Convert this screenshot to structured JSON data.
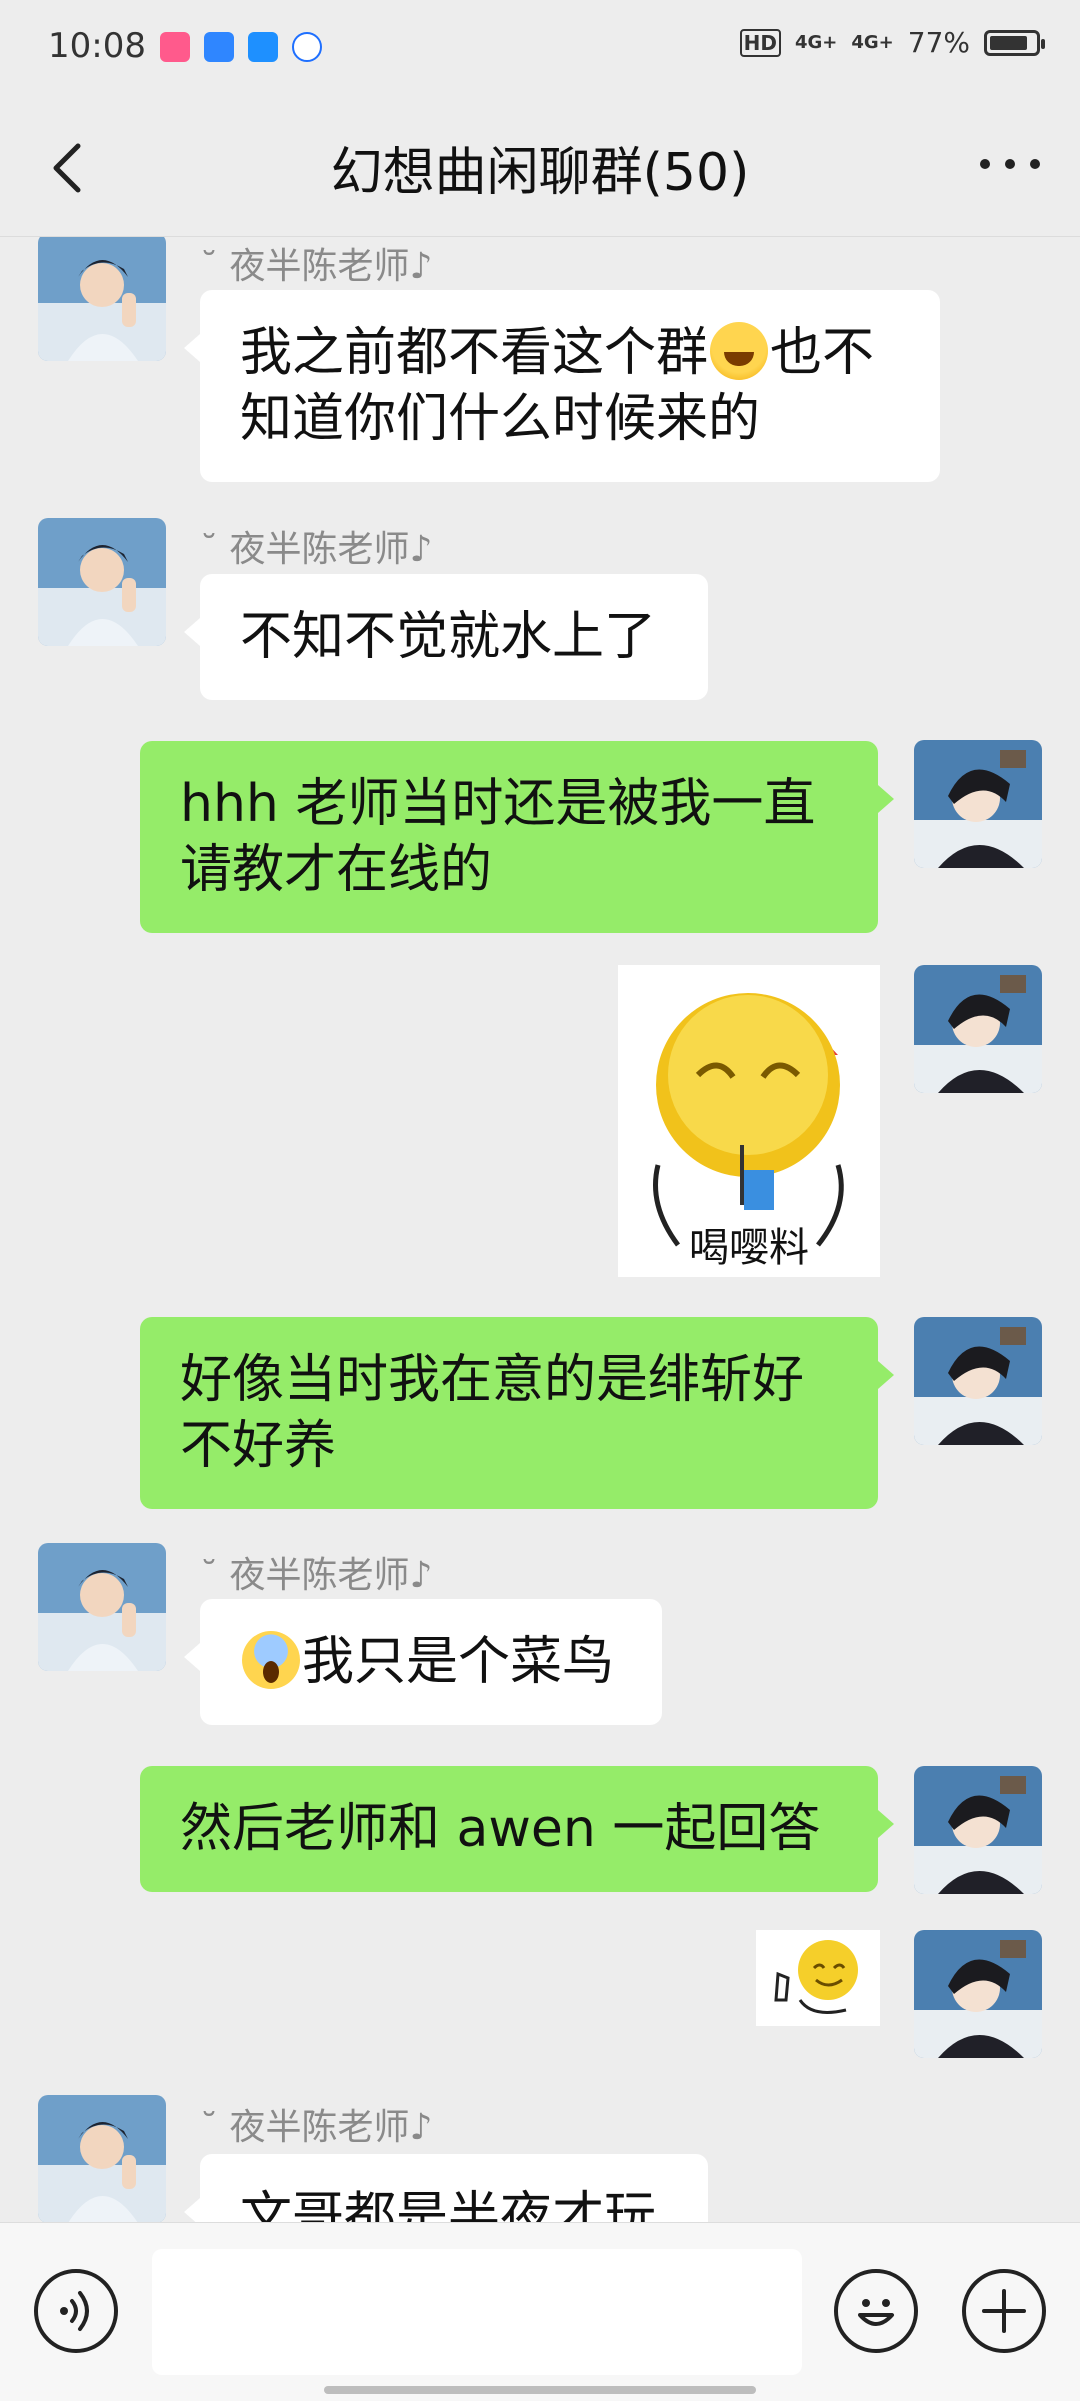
{
  "status_bar": {
    "time": "10:08",
    "hd": "HD",
    "signal1": "4G+",
    "signal2": "4G+",
    "battery_text": "77%",
    "battery_level": 0.77
  },
  "header": {
    "title": "幻想曲闲聊群(50)"
  },
  "messages": [
    {
      "sender": "˘ 夜半陈老师♪",
      "text_a": "我之前都不看这个群",
      "text_b": "也不知道你们什么时候来的",
      "emoji": "laughing-tears-emoji"
    },
    {
      "sender": "˘ 夜半陈老师♪",
      "text": "不知不觉就水上了"
    },
    {
      "text": "hhh 老师当时还是被我一直请教才在线的"
    },
    {
      "sticker_caption": "喝嘤料"
    },
    {
      "text": "好像当时我在意的是绯斩好不好养"
    },
    {
      "sender": "˘ 夜半陈老师♪",
      "text": "我只是个菜鸟",
      "emoji": "screaming-face-emoji"
    },
    {
      "text": "然后老师和 awen 一起回答"
    },
    {
      "sticker": "thumbs-up-sticker"
    },
    {
      "sender": "˘ 夜半陈老师♪",
      "text": "文哥都是半夜才玩"
    }
  ],
  "input": {
    "placeholder": ""
  },
  "icons": {
    "back": "back-chevron-icon",
    "more": "more-dots-icon",
    "voice": "voice-icon",
    "emoji": "emoji-icon",
    "plus": "plus-icon"
  },
  "colors": {
    "background": "#ededed",
    "outgoing_bubble": "#95ec69",
    "incoming_bubble": "#ffffff"
  }
}
